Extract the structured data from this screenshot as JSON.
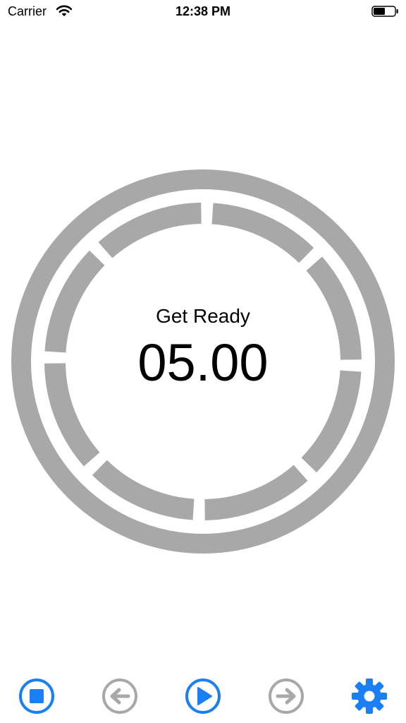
{
  "status_bar": {
    "carrier": "Carrier",
    "time": "12:38 PM",
    "wifi_icon": "wifi-icon",
    "battery_icon": "battery-icon",
    "battery_level": 0.55
  },
  "timer": {
    "phase": "Get Ready",
    "countdown": "05.00",
    "ring_color": "#a8a8a8",
    "interval_segments": 8
  },
  "toolbar": {
    "accent_color": "#1a7ef5",
    "disabled_color": "#a8a8a8",
    "buttons": [
      {
        "icon": "stop-icon",
        "enabled": true
      },
      {
        "icon": "previous-icon",
        "enabled": false
      },
      {
        "icon": "play-icon",
        "enabled": true
      },
      {
        "icon": "next-icon",
        "enabled": false
      },
      {
        "icon": "settings-icon",
        "enabled": true
      }
    ]
  }
}
